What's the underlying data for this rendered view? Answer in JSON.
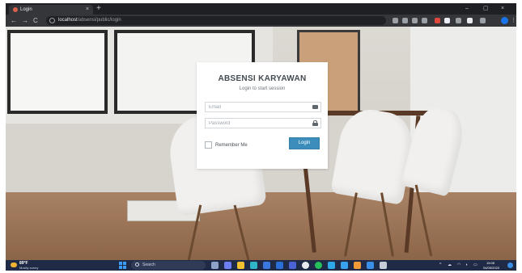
{
  "browser": {
    "tab": {
      "title": "Login",
      "close": "×"
    },
    "new_tab": "+",
    "window_controls": {
      "minimize": "–",
      "restore": "▢",
      "close": "×"
    },
    "nav": {
      "back": "←",
      "forward": "→",
      "reload": "C"
    },
    "url": {
      "host": "localhost",
      "path": "/absensi/public/login"
    }
  },
  "login": {
    "title": "ABSENSI KARYAWAN",
    "subtitle": "Login to start session",
    "email_placeholder": "Email",
    "password_placeholder": "Password",
    "remember_label": "Remember Me",
    "button_label": "Login"
  },
  "taskbar": {
    "weather_temp": "89°F",
    "weather_desc": "Mostly sunny",
    "search_label": "Search",
    "time": "15:08",
    "date": "04/05/2023"
  }
}
